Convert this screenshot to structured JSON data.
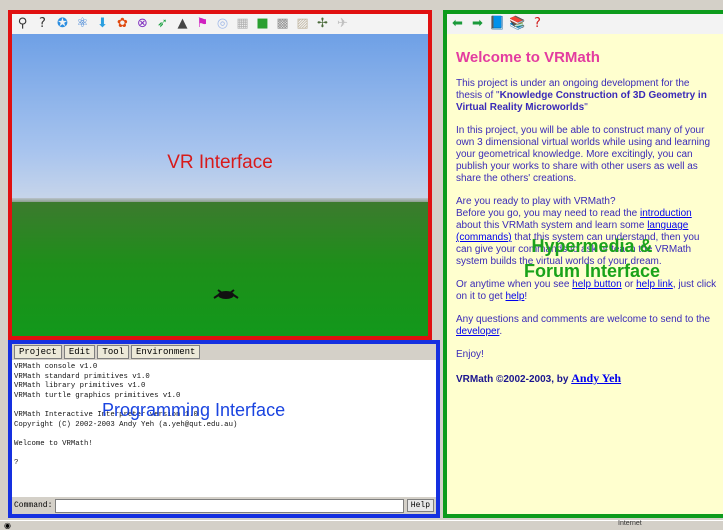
{
  "vr_panel": {
    "label": "VR Interface",
    "toolbar_icons": [
      {
        "name": "dropper-icon",
        "glyph": "⚲",
        "color": "#333"
      },
      {
        "name": "help-cursor-icon",
        "glyph": "?",
        "color": "#333"
      },
      {
        "name": "star-icon",
        "glyph": "✪",
        "color": "#2a8de0"
      },
      {
        "name": "atom-icon",
        "glyph": "⚛",
        "color": "#1f6fd0"
      },
      {
        "name": "download-icon",
        "glyph": "⬇",
        "color": "#2a9fe0"
      },
      {
        "name": "flower-icon",
        "glyph": "✿",
        "color": "#e04a10"
      },
      {
        "name": "cross-circle-icon",
        "glyph": "⊗",
        "color": "#8030c0"
      },
      {
        "name": "arrow-curve-icon",
        "glyph": "➶",
        "color": "#1aa040"
      },
      {
        "name": "cone-icon",
        "glyph": "▲",
        "color": "#444"
      },
      {
        "name": "flag-icon",
        "glyph": "⚑",
        "color": "#d020c0"
      },
      {
        "name": "sphere-icon",
        "glyph": "◎",
        "color": "#9fb8e8"
      },
      {
        "name": "grid-icon",
        "glyph": "▦",
        "color": "#b0b0b0"
      },
      {
        "name": "cube-icon",
        "glyph": "■",
        "color": "#2a9f30"
      },
      {
        "name": "checker-icon",
        "glyph": "▩",
        "color": "#909090"
      },
      {
        "name": "box-icon",
        "glyph": "▨",
        "color": "#bfb49e"
      },
      {
        "name": "turtle-icon",
        "glyph": "✢",
        "color": "#4a6a3a"
      },
      {
        "name": "plane-icon",
        "glyph": "✈",
        "color": "#c0c0c0"
      }
    ]
  },
  "programming_panel": {
    "label": "Programming Interface",
    "menus": [
      "Project",
      "Edit",
      "Tool",
      "Environment"
    ],
    "console_lines": [
      "VRMath console v1.0",
      "VRMath standard primitives v1.0",
      "VRMath library primitives v1.0",
      "VRMath turtle graphics primitives v1.0",
      "",
      "VRMath Interactive Interpreter version 1.0",
      "Copyright (C) 2002-2003 Andy Yeh (a.yeh@qut.edu.au)",
      "",
      "Welcome to VRMath!",
      "",
      "?"
    ],
    "command_label": "Command:",
    "help_label": "Help"
  },
  "hyper_panel": {
    "label_line1": "Hypermedia &",
    "label_line2": "Forum Interface",
    "toolbar_icons": [
      {
        "name": "back-icon",
        "glyph": "⬅",
        "color": "#1a9a3a"
      },
      {
        "name": "forward-icon",
        "glyph": "➡",
        "color": "#1a9a3a"
      },
      {
        "name": "book-icon",
        "glyph": "📘",
        "color": "#c04010"
      },
      {
        "name": "books-icon",
        "glyph": "📚",
        "color": "#c04010"
      },
      {
        "name": "help-icon",
        "glyph": "?",
        "color": "#d01818"
      }
    ],
    "title": "Welcome to VRMath",
    "p1_pre": "This project is under an ongoing development for the thesis of \"",
    "p1_bold": "Knowledge Construction of 3D Geometry in Virtual Reality Microworlds",
    "p1_post": "\"",
    "p2": "In this project, you will be able to construct many of your own 3 dimensional virtual worlds while using and learning your geometrical knowledge. More excitingly, you can publish your works to share with other users as well as share the others' creations.",
    "p3": "Are you ready to play with VRMath?",
    "p4_a": "Before you go, you may need to read the ",
    "p4_link1": "introduction",
    "p4_b": " about this VRMath system and learn some ",
    "p4_link2": "language (commands)",
    "p4_c": " that this system can understand, then you can give your commands to ask or teach the VRMath system builds the virtual worlds of your dream.",
    "p5_a": "Or anytime when you see ",
    "p5_link1": "help button",
    "p5_b": " or ",
    "p5_link2": "help link",
    "p5_c": ", just click on it to get ",
    "p5_link3": "help",
    "p5_d": "!",
    "p6_a": "Any questions and comments are welcome to send to the ",
    "p6_link": "developer",
    "p6_b": ".",
    "p7": "Enjoy!",
    "copyright": "VRMath ©2002-2003, by ",
    "author": "Andy Yeh"
  },
  "status_bar": {
    "zone": "Internet"
  }
}
